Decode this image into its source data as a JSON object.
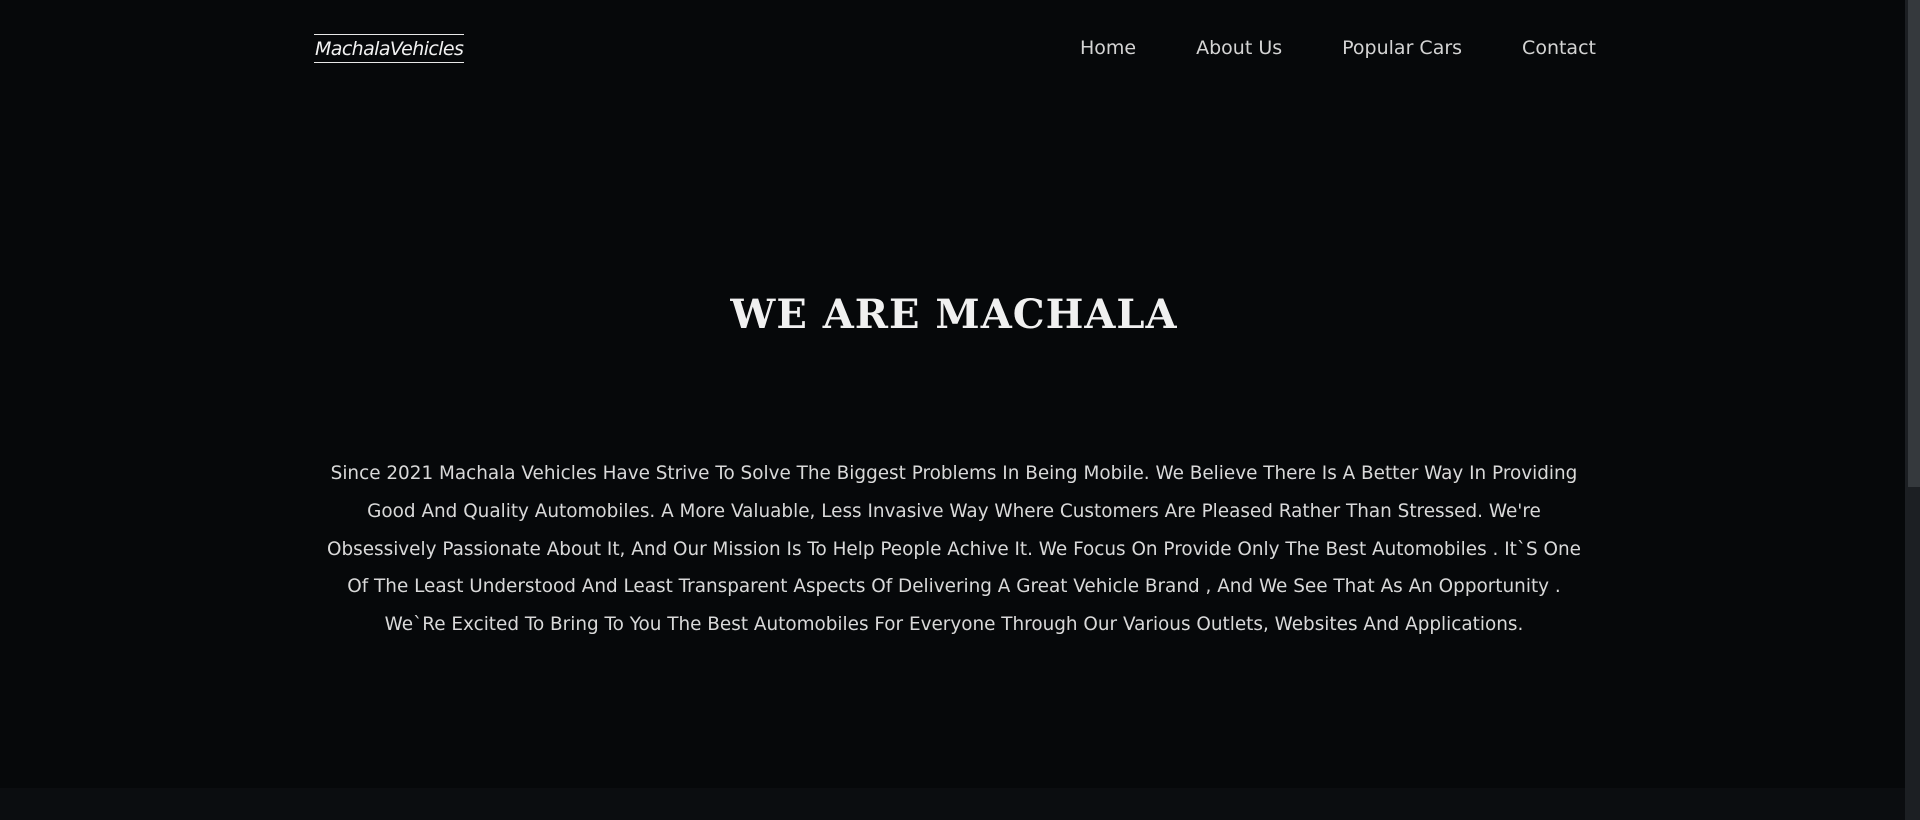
{
  "brand": {
    "name": "MachalaVehicles"
  },
  "nav": {
    "items": [
      {
        "label": "Home"
      },
      {
        "label": "About Us"
      },
      {
        "label": "Popular Cars"
      },
      {
        "label": "Contact"
      }
    ]
  },
  "hero": {
    "title": "WE ARE MACHALA",
    "paragraph": "Since 2021 Machala Vehicles Have Strive To Solve The Biggest Problems In Being Mobile. We Believe There Is A Better Way In Providing Good And Quality Automobiles. A More Valuable, Less Invasive Way Where Customers Are Pleased Rather Than Stressed. We're Obsessively Passionate About It, And Our Mission Is To Help People Achive It. We Focus On Provide Only The Best Automobiles . It`S One Of The Least Understood And Least Transparent Aspects Of Delivering A Great Vehicle Brand , And We See That As An Opportunity . We`Re Excited To Bring To You The Best Automobiles For Everyone Through Our Various Outlets, Websites And Applications."
  },
  "colors": {
    "background": "#06080a",
    "text": "#d9d9d9",
    "title": "#f0f0f0"
  }
}
